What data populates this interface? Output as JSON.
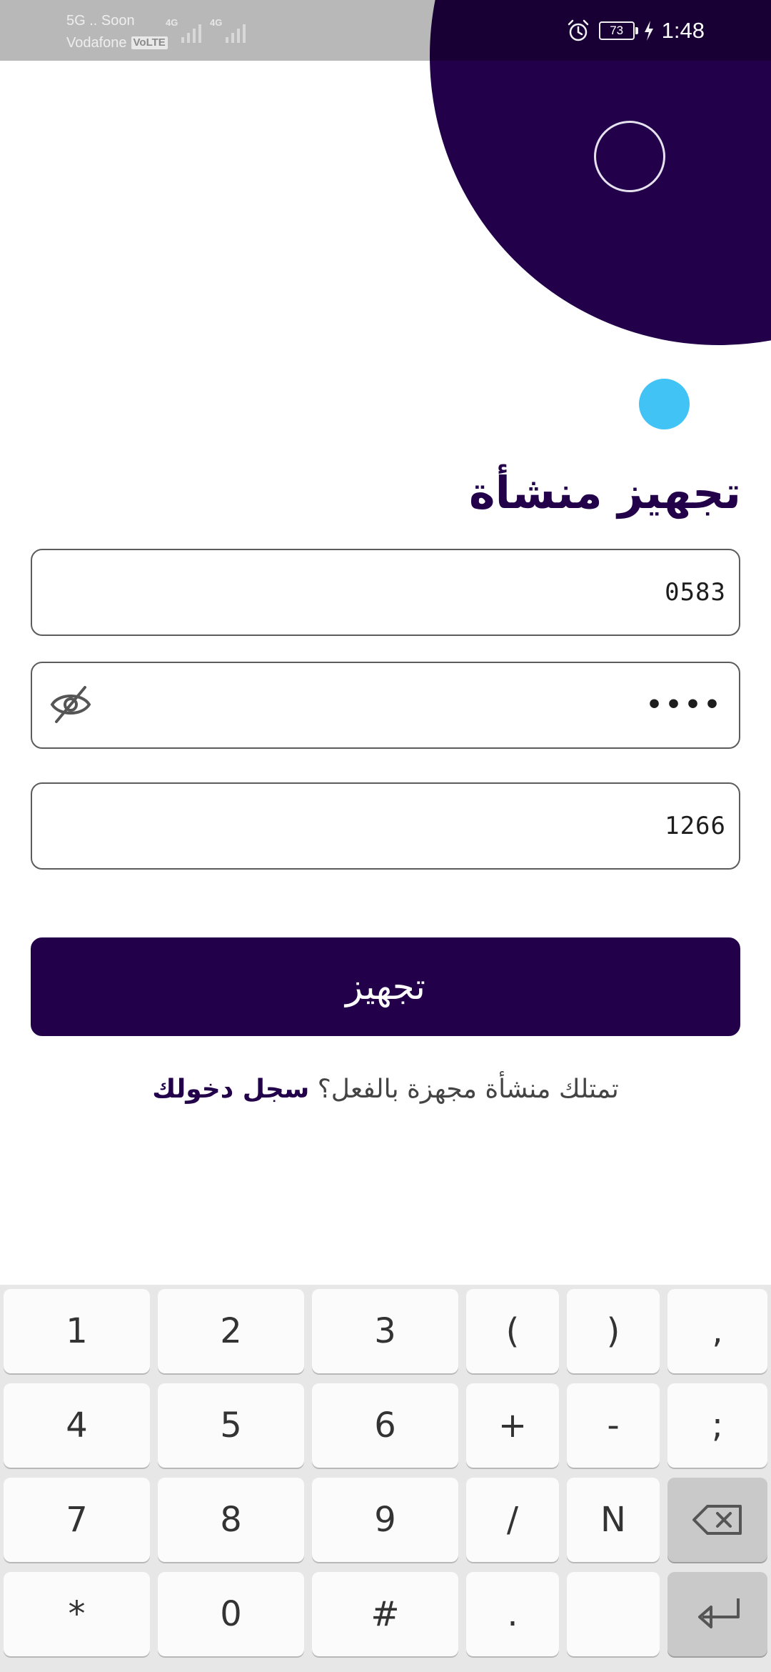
{
  "status_bar": {
    "carrier_line1": "5G .. Soon",
    "carrier_line2": "Vodafone",
    "volte_badge": "VoLTE",
    "sim1_network": "4G",
    "sim2_network": "4G",
    "alarm_icon": "alarm-clock-icon",
    "battery_level": "73",
    "charging_icon": "lightning-icon",
    "time": "1:48"
  },
  "form": {
    "title": "تجهيز منشأة",
    "field1_value": "0583",
    "password_dots": "••••",
    "password_toggle_icon": "eye-off-icon",
    "field3_value": "1266",
    "submit_label": "تجهيز",
    "login_prompt": "تمتلك منشأة مجهزة بالفعل؟",
    "login_link": "سجل دخولك"
  },
  "keyboard": {
    "row1": [
      "1",
      "2",
      "3",
      "(",
      ")",
      ","
    ],
    "row2": [
      "4",
      "5",
      "6",
      "+",
      "-",
      ";"
    ],
    "row3": [
      "7",
      "8",
      "9",
      "/",
      "N"
    ],
    "row3_func_icon": "backspace-icon",
    "row4": [
      "*",
      "0",
      "#",
      ".",
      ""
    ],
    "row4_func_icon": "enter-icon"
  },
  "colors": {
    "brand_primary": "#22004a",
    "accent_dot": "#41c3f5"
  }
}
